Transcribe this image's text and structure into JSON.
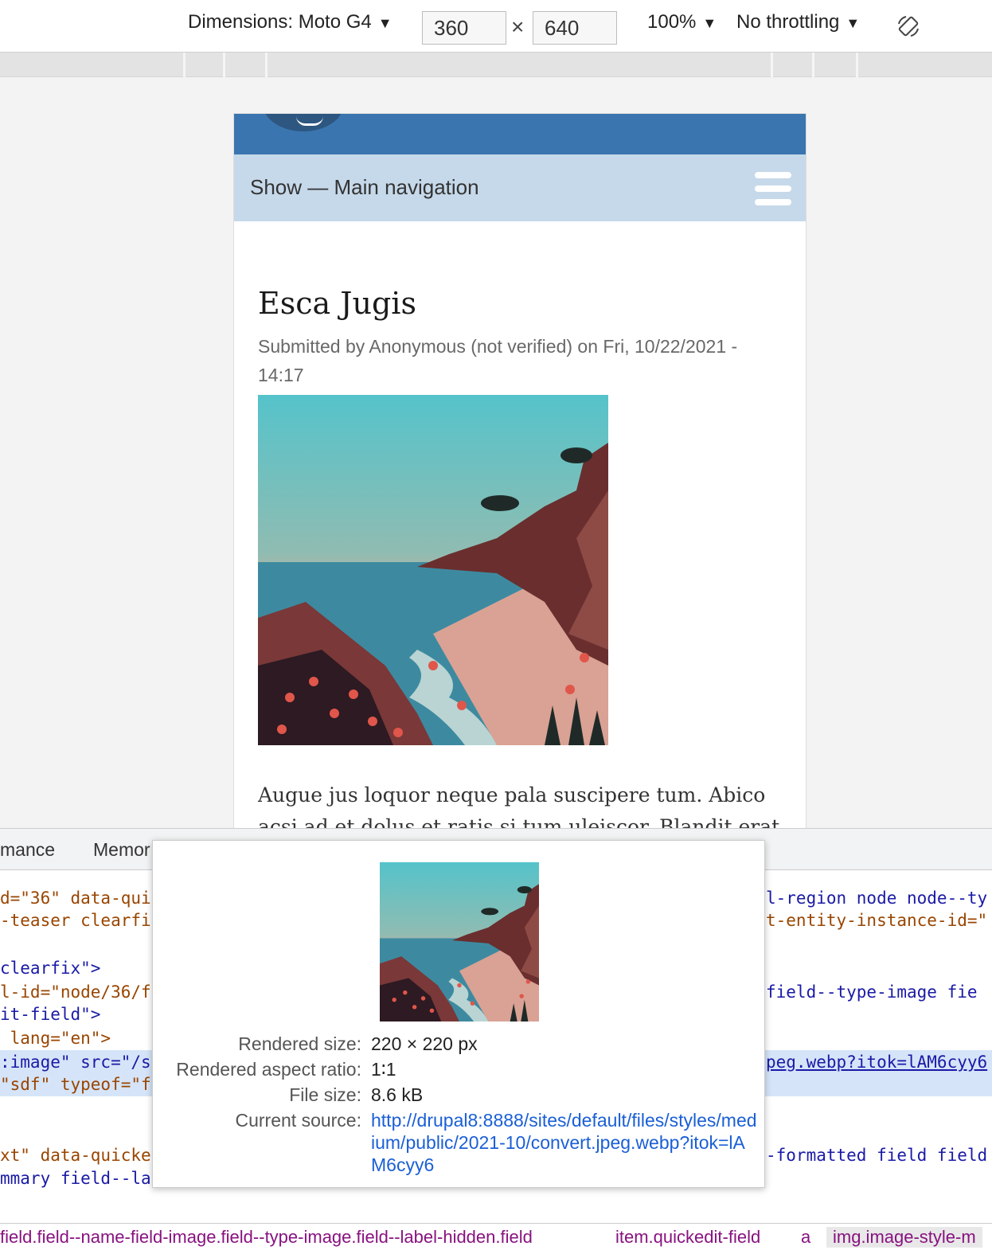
{
  "toolbar": {
    "dimensions_label": "Dimensions: Moto G4",
    "width_value": "360",
    "height_value": "640",
    "times": "×",
    "zoom": "100%",
    "throttling": "No throttling",
    "dropdown_arrow": "▼"
  },
  "page": {
    "nav_toggle": "Show — Main navigation",
    "title": "Esca Jugis",
    "meta": "Submitted by Anonymous (not verified) on Fri, 10/22/2021 - 14:17",
    "body": "Augue jus loquor neque pala suscipere tum. Abico acsi ad et dolus et ratis si tum uleiscor. Blandit erat et"
  },
  "devtools": {
    "tabs": [
      "mance",
      "Memor"
    ],
    "code_lines": [
      {
        "left": "d=\"36\" data-qui",
        "right": "l-region node node--ty"
      },
      {
        "left": "-teaser clearfi",
        "right": "t-entity-instance-id=\""
      },
      {
        "left": "clearfix\">",
        "right": ""
      },
      {
        "left": "l-id=\"node/36/f",
        "right": "field--type-image fie"
      },
      {
        "left": "it-field\">",
        "right": ""
      },
      {
        "left": " lang=\"en\">",
        "right": ""
      },
      {
        "left": ":image\" src=\"/s",
        "right": "peg.webp?itok=lAM6cyy6"
      },
      {
        "left": "\"sdf\" typeof=\"f",
        "right": ""
      },
      {
        "left": "xt\" data-quicke",
        "right": "-formatted field field"
      },
      {
        "left": "mmary field--la",
        "right": ""
      }
    ],
    "breadcrumbs": [
      "field.field--name-field-image.field--type-image.field--label-hidden.field",
      "item.quickedit-field",
      "a",
      "img.image-style-m"
    ]
  },
  "tooltip": {
    "rendered_size_label": "Rendered size:",
    "rendered_size_value": "220 × 220 px",
    "aspect_label": "Rendered aspect ratio:",
    "aspect_value": "1∶1",
    "file_size_label": "File size:",
    "file_size_value": "8.6 kB",
    "source_label": "Current source:",
    "source_url": "http://drupal8:8888/sites/default/files/styles/medium/public/2021-10/convert.jpeg.webp?itok=lAM6cyy6"
  },
  "colors": {
    "header_blue": "#3a75af",
    "nav_bg": "#c6d9ea",
    "link": "#1a5fd6",
    "selection": "#d5e4f8"
  }
}
